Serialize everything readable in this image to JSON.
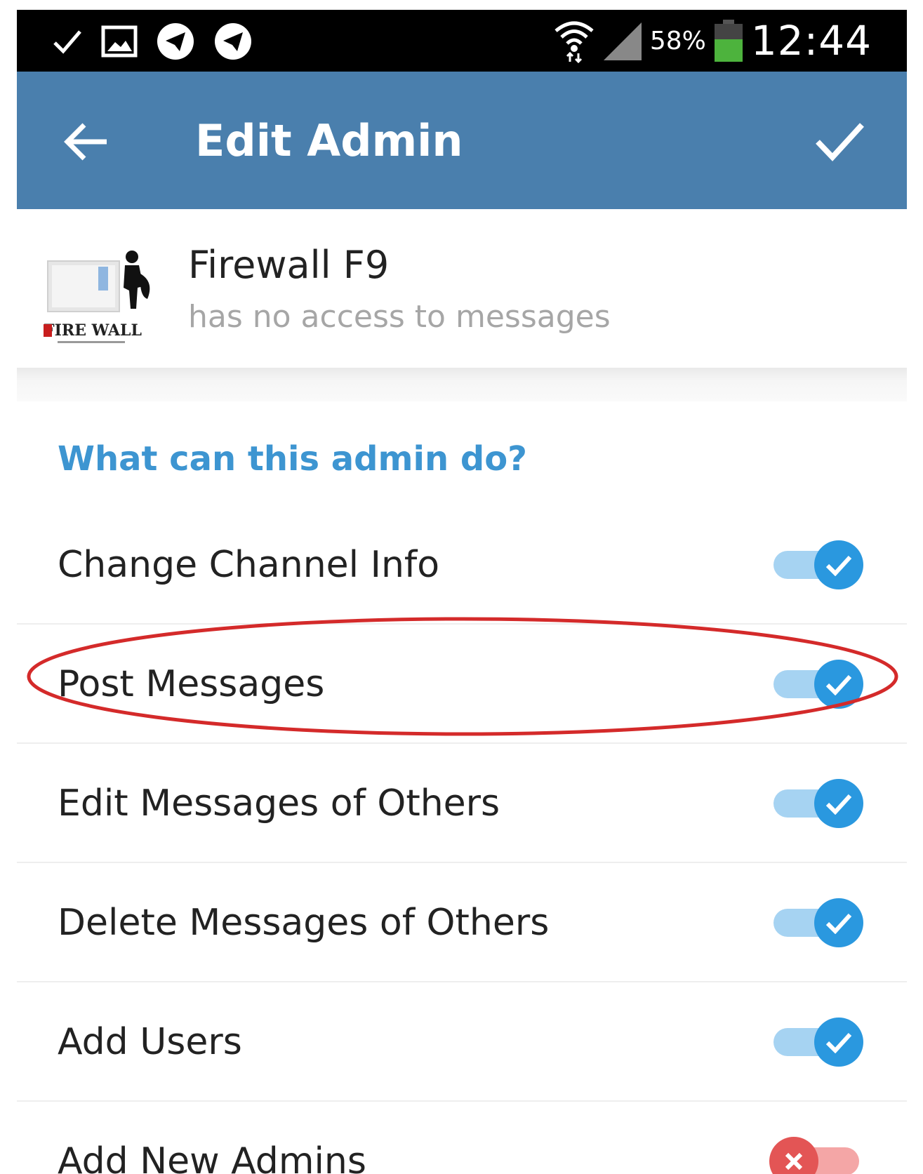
{
  "status_bar": {
    "battery_percent": "58%",
    "time": "12:44",
    "icons": [
      "check-icon",
      "image-icon",
      "telegram-icon",
      "telegram-icon",
      "wifi-icon",
      "signal-icon",
      "battery-icon"
    ]
  },
  "toolbar": {
    "title": "Edit Admin",
    "back_icon": "arrow-left-icon",
    "done_icon": "check-icon",
    "background_color": "#4a7fad"
  },
  "user": {
    "name": "Firewall F9",
    "status": "has no access to messages",
    "avatar_logo_text": "FIRE WALL"
  },
  "permissions": {
    "section_title": "What can this admin do?",
    "accent_color": "#3d95d1",
    "items": [
      {
        "label": "Change Channel Info",
        "enabled": true
      },
      {
        "label": "Post Messages",
        "enabled": true,
        "highlighted": true
      },
      {
        "label": "Edit Messages of Others",
        "enabled": true
      },
      {
        "label": "Delete Messages of Others",
        "enabled": true
      },
      {
        "label": "Add Users",
        "enabled": true
      },
      {
        "label": "Add New Admins",
        "enabled": false
      }
    ]
  },
  "colors": {
    "toggle_on": "#2a98df",
    "toggle_off": "#e35555",
    "highlight_ring": "#d42a2a"
  }
}
